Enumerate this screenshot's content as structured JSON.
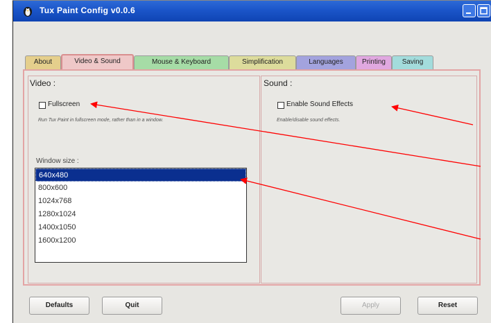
{
  "window": {
    "title": "Tux Paint Config v0.0.6"
  },
  "tabs": [
    {
      "label": "About"
    },
    {
      "label": "Video & Sound"
    },
    {
      "label": "Mouse & Keyboard"
    },
    {
      "label": "Simplification"
    },
    {
      "label": "Languages"
    },
    {
      "label": "Printing"
    },
    {
      "label": "Saving"
    }
  ],
  "video": {
    "heading": "Video :",
    "fullscreen_label": "Fullscreen",
    "fullscreen_checked": false,
    "fullscreen_hint": "Run Tux Paint in fullscreen mode, rather than in a window.",
    "window_size_label": "Window size :",
    "sizes": [
      "640x480",
      "800x600",
      "1024x768",
      "1280x1024",
      "1400x1050",
      "1600x1200"
    ],
    "selected_size": "640x480"
  },
  "sound": {
    "heading": "Sound :",
    "effects_label": "Enable Sound Effects",
    "effects_checked": false,
    "effects_hint": "Enable/disable sound effects."
  },
  "buttons": {
    "defaults": "Defaults",
    "quit": "Quit",
    "apply": "Apply",
    "reset": "Reset"
  },
  "colors": {
    "titlebar": "#1b55c9",
    "selected_item": "#0a2f8f",
    "annotation_arrow": "#ff0000"
  }
}
